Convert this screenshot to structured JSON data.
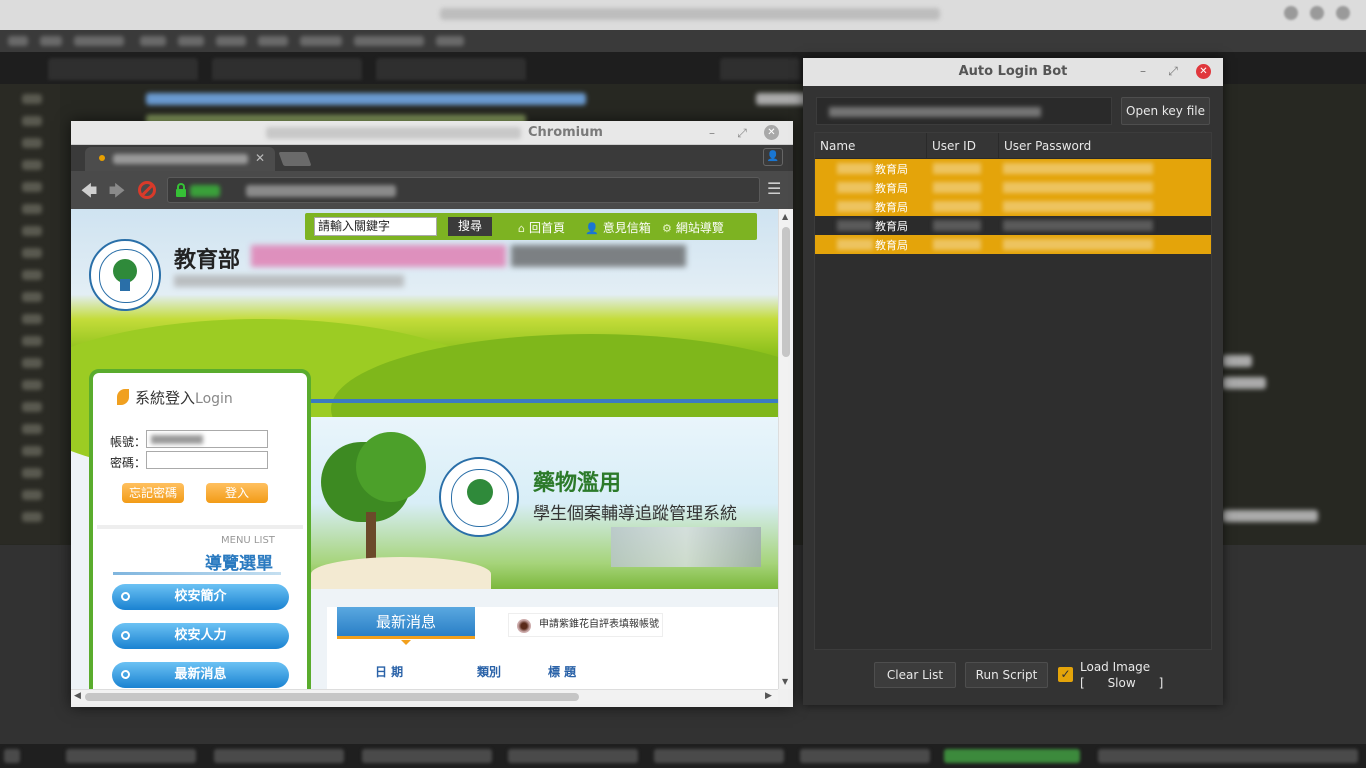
{
  "chromium": {
    "title": "Chromium",
    "tab_close": "✕",
    "user_icon_glyph": "👤",
    "nav": {
      "back": "🡄",
      "forward": "🡆",
      "star": "☆",
      "menu": "☰"
    },
    "window_controls": {
      "minimize": "–",
      "maximize": "⤢",
      "close": "✕"
    },
    "scroll": {
      "up": "▲",
      "down": "▼",
      "left": "◀",
      "right": "▶"
    }
  },
  "site": {
    "search_placeholder": "請輸入關鍵字",
    "search_button": "搜尋",
    "nav_links": [
      {
        "icon": "home-icon",
        "glyph": "⌂",
        "label": "回首頁"
      },
      {
        "icon": "person-icon",
        "glyph": "👤",
        "label": "意見信箱"
      },
      {
        "icon": "sitemap-icon",
        "glyph": "⚙",
        "label": "網站導覽"
      }
    ],
    "org_name": "教育部",
    "login": {
      "title_zh": "系統登入",
      "title_en": "Login",
      "account_label": "帳號：",
      "password_label": "密碼：",
      "forgot_button": "忘記密碼",
      "login_button": "登入"
    },
    "menu": {
      "label_en": "MENU LIST",
      "label_zh": "導覽選單",
      "items": [
        "校安簡介",
        "校安人力",
        "最新消息"
      ]
    },
    "feature": {
      "title": "藥物濫用",
      "subtitle": "學生個案輔導追蹤管理系統"
    },
    "news": {
      "tab": "最新消息",
      "side_link": "申請紫錐花自評表填報帳號",
      "columns": [
        "日 期",
        "類別",
        "標 題"
      ]
    }
  },
  "bot": {
    "title": "Auto Login Bot",
    "window_controls": {
      "minimize": "–",
      "maximize": "⤢",
      "close": "✕"
    },
    "open_key_button": "Open key file",
    "columns": [
      "Name",
      "User ID",
      "User Password"
    ],
    "rows": [
      {
        "name_suffix": "教育局",
        "selected": true
      },
      {
        "name_suffix": "教育局",
        "selected": true
      },
      {
        "name_suffix": "教育局",
        "selected": true
      },
      {
        "name_suffix": "教育局",
        "selected": false
      },
      {
        "name_suffix": "教育局",
        "selected": true
      }
    ],
    "clear_button": "Clear List",
    "run_button": "Run Script",
    "load_image_checked": true,
    "load_image_label": "Load Image",
    "load_image_sub": "[      Slow      ]",
    "check_glyph": "✓"
  },
  "colors": {
    "selection": "#e4a40a",
    "bot_bg": "#333333",
    "site_green": "#7db322",
    "close_red": "#e0373c"
  }
}
